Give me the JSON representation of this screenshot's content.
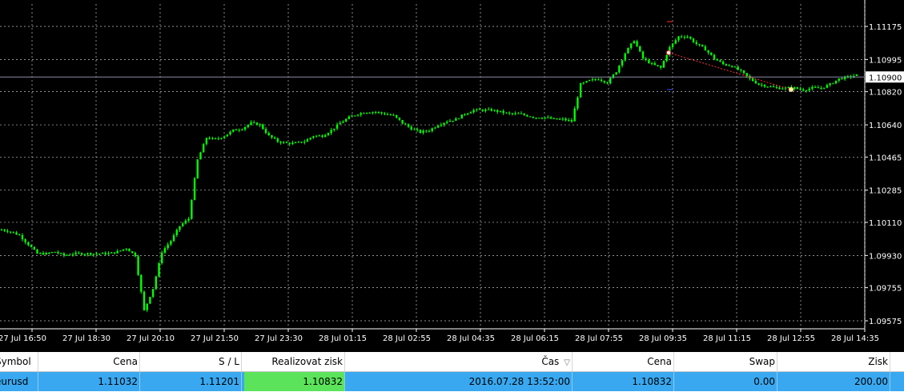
{
  "chart": {
    "price_labels": [
      "1.11175",
      "1.10995",
      "1.10820",
      "1.10640",
      "1.10465",
      "1.10285",
      "1.10110",
      "1.09930",
      "1.09755",
      "1.09575"
    ],
    "price_levels": [
      1.11175,
      1.10995,
      1.1082,
      1.1064,
      1.10465,
      1.10285,
      1.1011,
      1.0993,
      1.09755,
      1.09575
    ],
    "current_price": "1.10900",
    "current_price_value": 1.109,
    "time_labels": [
      "27 Jul 16:50",
      "27 Jul 18:30",
      "27 Jul 20:10",
      "27 Jul 21:50",
      "27 Jul 23:30",
      "28 Jul 01:15",
      "28 Jul 02:55",
      "28 Jul 04:35",
      "28 Jul 06:15",
      "28 Jul 07:55",
      "28 Jul 09:35",
      "28 Jul 11:15",
      "28 Jul 12:55",
      "28 Jul 14:35"
    ],
    "colors": {
      "background": "#000000",
      "candle": "#00ff00",
      "grid": "#c0c0c0",
      "trend": "#ff3030",
      "axis_text": "#ffffff"
    }
  },
  "chart_data": {
    "type": "candlestick",
    "symbol": "eurusd",
    "y_range": [
      1.0957,
      1.1125
    ],
    "x_start_label": "27 Jul 16:50",
    "x_end_label": "28 Jul 14:35",
    "close_series": [
      1.1007,
      1.1006,
      1.1004,
      1.0999,
      1.0994,
      1.0994,
      1.0995,
      1.0993,
      1.0994,
      1.0994,
      1.0994,
      1.0994,
      1.0994,
      1.0995,
      1.0997,
      1.0993,
      1.0963,
      1.0975,
      1.0995,
      1.1001,
      1.1009,
      1.1013,
      1.1045,
      1.1057,
      1.1056,
      1.1058,
      1.1061,
      1.1062,
      1.1065,
      1.1064,
      1.1058,
      1.1055,
      1.1054,
      1.1054,
      1.1055,
      1.1058,
      1.1058,
      1.1061,
      1.1065,
      1.1068,
      1.107,
      1.1071,
      1.1071,
      1.107,
      1.1069,
      1.1065,
      1.1062,
      1.106,
      1.1061,
      1.1064,
      1.1066,
      1.1067,
      1.107,
      1.1072,
      1.1072,
      1.1072,
      1.1071,
      1.107,
      1.107,
      1.1069,
      1.1068,
      1.1068,
      1.1067,
      1.1067,
      1.1066,
      1.1086,
      1.1088,
      1.1089,
      1.1087,
      1.1093,
      1.1103,
      1.111,
      1.11,
      1.1097,
      1.1095,
      1.1106,
      1.1112,
      1.1112,
      1.1108,
      1.1105,
      1.11,
      1.1097,
      1.1096,
      1.1093,
      1.1089,
      1.1086,
      1.1085,
      1.1084,
      1.1084,
      1.1084,
      1.1083,
      1.1084,
      1.1084,
      1.1086,
      1.1089,
      1.109,
      1.1091
    ],
    "trade_marker": {
      "open_label": "1.11032",
      "close_label": "1.10832"
    }
  },
  "table": {
    "headers": {
      "symbol": "Symbol",
      "price": "Cena",
      "sl": "S / L",
      "tp": "Realizovat zisk",
      "time": "Čas",
      "close_price": "Cena",
      "swap": "Swap",
      "profit": "Zisk"
    },
    "sort_icon": "▽",
    "rows": [
      {
        "symbol": "eurusd",
        "price": "1.11032",
        "sl": "1.11201",
        "tp": "1.10832",
        "time": "2016.07.28 13:52:00",
        "close_price": "1.10832",
        "swap": "0.00",
        "profit": "200.00"
      }
    ]
  }
}
